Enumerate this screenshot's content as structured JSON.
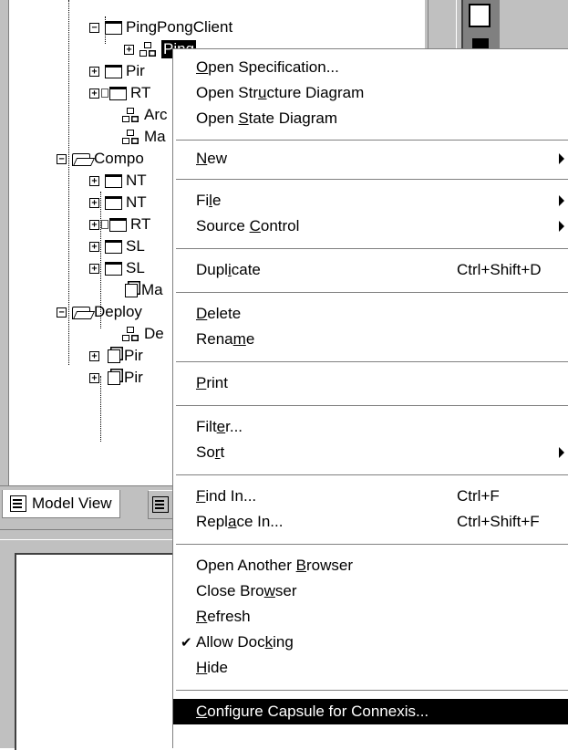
{
  "tree": {
    "items": [
      {
        "label": "PingPongClient",
        "icon": "folder-icon"
      },
      {
        "label": "Ping",
        "icon": "capsule-icon",
        "selected": true
      },
      {
        "label": "Pir",
        "icon": "folder-icon"
      },
      {
        "label": "RT",
        "icon": "folder-icon"
      },
      {
        "label": "Arc",
        "icon": "diagram-icon"
      },
      {
        "label": "Ma",
        "icon": "diagram-icon"
      },
      {
        "label": "Compo",
        "icon": "open-folder-icon"
      },
      {
        "label": "NT",
        "icon": "folder-icon"
      },
      {
        "label": "NT",
        "icon": "folder-icon"
      },
      {
        "label": "RT",
        "icon": "folder-icon"
      },
      {
        "label": "SL",
        "icon": "folder-icon"
      },
      {
        "label": "SL",
        "icon": "folder-icon"
      },
      {
        "label": "Ma",
        "icon": "component-diagram-icon"
      },
      {
        "label": "Deploy",
        "icon": "open-folder-icon"
      },
      {
        "label": "De",
        "icon": "deployment-diagram-icon"
      },
      {
        "label": "Pir",
        "icon": "node-icon"
      },
      {
        "label": "Pir",
        "icon": "node-icon"
      }
    ]
  },
  "tabs": [
    {
      "label": "Model View",
      "icon": "model-view-icon"
    }
  ],
  "context_menu": {
    "items": [
      {
        "pre": "",
        "u": "O",
        "post": "pen Specification...",
        "shortcut": "",
        "submenu": false
      },
      {
        "pre": "Open Str",
        "u": "u",
        "post": "cture Diagram",
        "shortcut": "",
        "submenu": false
      },
      {
        "pre": "Open ",
        "u": "S",
        "post": "tate Diagram",
        "shortcut": "",
        "submenu": false
      },
      {
        "pre": "",
        "u": "N",
        "post": "ew",
        "shortcut": "",
        "submenu": true
      },
      {
        "pre": "Fi",
        "u": "l",
        "post": "e",
        "shortcut": "",
        "submenu": true
      },
      {
        "pre": "Source ",
        "u": "C",
        "post": "ontrol",
        "shortcut": "",
        "submenu": true
      },
      {
        "pre": "Dupl",
        "u": "i",
        "post": "cate",
        "shortcut": "Ctrl+Shift+D",
        "submenu": false
      },
      {
        "pre": "",
        "u": "D",
        "post": "elete",
        "shortcut": "",
        "submenu": false
      },
      {
        "pre": "Rena",
        "u": "m",
        "post": "e",
        "shortcut": "",
        "submenu": false
      },
      {
        "pre": "",
        "u": "P",
        "post": "rint",
        "shortcut": "",
        "submenu": false
      },
      {
        "pre": "Filt",
        "u": "e",
        "post": "r...",
        "shortcut": "",
        "submenu": false
      },
      {
        "pre": "So",
        "u": "r",
        "post": "t",
        "shortcut": "",
        "submenu": true
      },
      {
        "pre": "",
        "u": "F",
        "post": "ind In...",
        "shortcut": "Ctrl+F",
        "submenu": false
      },
      {
        "pre": "Repl",
        "u": "a",
        "post": "ce In...",
        "shortcut": "Ctrl+Shift+F",
        "submenu": false
      },
      {
        "pre": "Open Another ",
        "u": "B",
        "post": "rowser",
        "shortcut": "",
        "submenu": false
      },
      {
        "pre": "Close Bro",
        "u": "w",
        "post": "ser",
        "shortcut": "",
        "submenu": false
      },
      {
        "pre": "",
        "u": "R",
        "post": "efresh",
        "shortcut": "",
        "submenu": false
      },
      {
        "pre": "Allow Doc",
        "u": "k",
        "post": "ing",
        "shortcut": "",
        "submenu": false,
        "checked": true
      },
      {
        "pre": "",
        "u": "H",
        "post": "ide",
        "shortcut": "",
        "submenu": false
      },
      {
        "pre": "",
        "u": "C",
        "post": "onfigure Capsule for Connexis...",
        "shortcut": "",
        "submenu": false,
        "highlighted": true
      }
    ],
    "check_glyph": "✔"
  }
}
